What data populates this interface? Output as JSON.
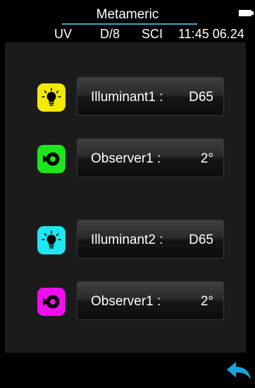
{
  "header": {
    "title": "Metameric",
    "status": {
      "light_source": "UV",
      "geometry": "D/8",
      "mode": "SCI",
      "datetime": "11:45 06.24"
    }
  },
  "rows": [
    {
      "icon": "bulb-icon",
      "icon_bg": "#f2ea00",
      "label": "Illuminant1 :",
      "value": "D65"
    },
    {
      "icon": "observer-icon",
      "icon_bg": "#1ee61e",
      "label": "Observer1 :",
      "value": "2°"
    },
    {
      "icon": "bulb-icon",
      "icon_bg": "#1fe6f0",
      "label": "Illuminant2 :",
      "value": "D65"
    },
    {
      "icon": "observer-icon",
      "icon_bg": "#f20cf2",
      "label": "Observer1 :",
      "value": "2°"
    }
  ],
  "footer": {
    "back_icon": "back-arrow-icon",
    "accent": "#1aa3dc"
  },
  "colors": {
    "background": "#000000",
    "panel": "#1b1b1b",
    "title_underline": "#3aa7b8"
  }
}
